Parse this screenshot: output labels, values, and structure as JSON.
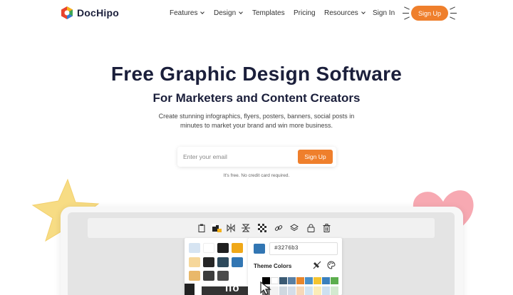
{
  "nav": {
    "logo_prefix": "Doc",
    "logo_suffix": "Hipo",
    "items": [
      {
        "label": "Features",
        "dropdown": true
      },
      {
        "label": "Design",
        "dropdown": true
      },
      {
        "label": "Templates",
        "dropdown": false
      },
      {
        "label": "Pricing",
        "dropdown": false
      },
      {
        "label": "Resources",
        "dropdown": true
      },
      {
        "label": "Sign In",
        "dropdown": false
      }
    ],
    "signup_label": "Sign Up"
  },
  "hero": {
    "title": "Free Graphic Design Software",
    "subtitle": "For Marketers and Content Creators",
    "description": "Create stunning infographics, flyers, posters, banners, social posts in minutes to market your brand and win more business.",
    "email_placeholder": "Enter your email",
    "cta_label": "Sign Up",
    "note": "It's free. No credit card required."
  },
  "editor": {
    "toolbar_icons": [
      "clipboard-icon",
      "color-fill-icon",
      "flip-horizontal-icon",
      "flip-vertical-icon",
      "transparency-icon",
      "link-icon",
      "layers-icon",
      "lock-icon",
      "trash-icon"
    ],
    "hex_value": "#3276b3",
    "theme_colors_label": "Theme Colors",
    "canvas_text": "llo"
  },
  "colors": {
    "accent": "#ef7f2c",
    "text_dark": "#1b1f3b",
    "selected_color": "#3276b3"
  }
}
